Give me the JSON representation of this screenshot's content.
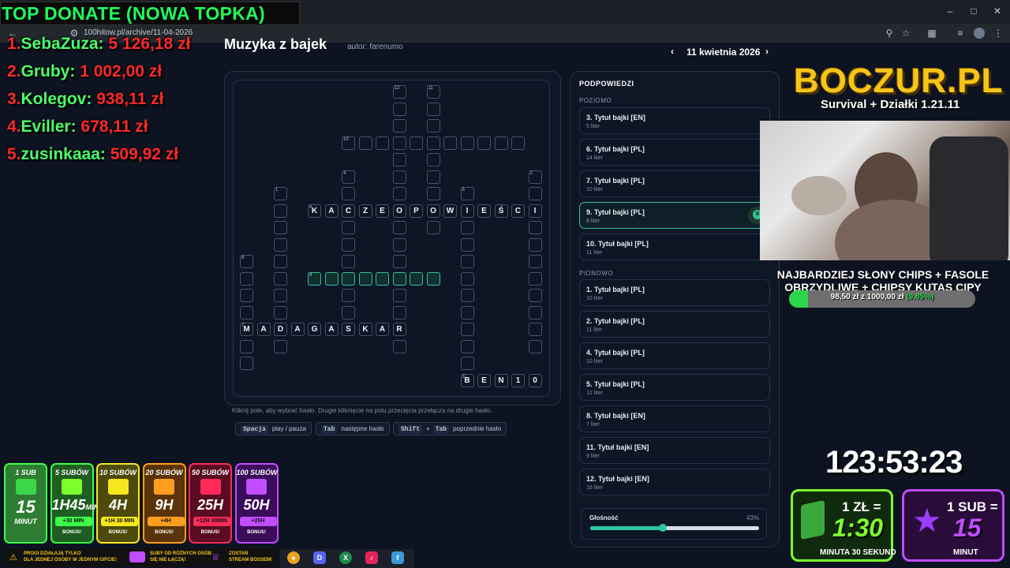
{
  "browser": {
    "url": "100hitow.pl/archive/11-04-2026",
    "window_controls": [
      "minimize-icon",
      "maximize-icon",
      "close-icon"
    ]
  },
  "donate": {
    "title": "TOP DONATE (NOWA TOPKA)",
    "entries": [
      {
        "rank": "1.",
        "name": "SebaZuza",
        "amount": "5 126,18 zł"
      },
      {
        "rank": "2.",
        "name": "Gruby",
        "amount": "1 002,00 zł"
      },
      {
        "rank": "3.",
        "name": "Kolegov",
        "amount": "938,11 zł"
      },
      {
        "rank": "4.",
        "name": "Eviller",
        "amount": "678,11 zł"
      },
      {
        "rank": "5.",
        "name": "zusinkaaa",
        "amount": "509,92 zł"
      }
    ]
  },
  "page": {
    "heading": "Muzyka z bajek",
    "author": "autor: farenumo",
    "date": "11 kwietnia 2026",
    "hint_text": "Kliknij pole, aby wybrać hasło. Drugie kliknięcie na polu przecięcia przełącza na drugie hasło.",
    "shortcuts": [
      {
        "key": "Spacja",
        "label": "play / pauza"
      },
      {
        "key": "Tab",
        "label": "następne hasło"
      },
      {
        "key": "Shift",
        "plus": "+",
        "key2": "Tab",
        "label": "poprzednie hasło"
      }
    ]
  },
  "hints": {
    "title": "PODPOWIEDZI",
    "across_title": "POZIOMO",
    "down_title": "PIONOWO",
    "across": [
      {
        "title": "3. Tytuł bajki [EN]",
        "sub": "5 liter"
      },
      {
        "title": "6. Tytuł bajki [PL]",
        "sub": "14 liter"
      },
      {
        "title": "7. Tytuł bajki [PL]",
        "sub": "10 liter"
      },
      {
        "title": "9. Tytuł bajki [PL]",
        "sub": "8 liter",
        "active": true
      },
      {
        "title": "10. Tytuł bajki [PL]",
        "sub": "11 liter"
      }
    ],
    "down": [
      {
        "title": "1. Tytuł bajki [PL]",
        "sub": "10 liter"
      },
      {
        "title": "2. Tytuł bajki [PL]",
        "sub": "11 liter"
      },
      {
        "title": "4. Tytuł bajki [PL]",
        "sub": "10 liter"
      },
      {
        "title": "5. Tytuł bajki [PL]",
        "sub": "12 liter"
      },
      {
        "title": "8. Tytuł bajki [EN]",
        "sub": "7 liter"
      },
      {
        "title": "11. Tytuł bajki [EN]",
        "sub": "9 liter"
      },
      {
        "title": "12. Tytuł bajki [EN]",
        "sub": "16 liter"
      }
    ],
    "volume_label": "Głośność",
    "volume_value": "43%",
    "volume_fraction": 0.43
  },
  "crossword": {
    "words": {
      "across_6": [
        "K",
        "A",
        "C",
        "Z",
        "E",
        "O",
        "P",
        "O",
        "W",
        "I",
        "E",
        "Ś",
        "C",
        "I"
      ],
      "across_7": [
        "M",
        "A",
        "D",
        "A",
        "G",
        "A",
        "S",
        "K",
        "A",
        "R"
      ],
      "across_3": [
        "B",
        "E",
        "N",
        "1",
        "0"
      ]
    },
    "clue_numbers": [
      "1",
      "2",
      "3",
      "4",
      "5",
      "6",
      "7",
      "8",
      "9",
      "10",
      "11",
      "12"
    ]
  },
  "overlay": {
    "logo_main": "BOCZUR.PL",
    "logo_sub": "Survival + Działki 1.21.11",
    "goal_line1": "NAJBARDZIEJ SŁONY CHIPS + FASOLE",
    "goal_line2": "OBRZYDLIWE + CHIPSY KUTAS CIPY",
    "goal_amount": "98,50 zł z 1000,00 zł",
    "goal_percent": "(9.85%)",
    "goal_fraction": 0.0985,
    "timer": "123:53:23",
    "rate_zl": {
      "top": "1 ZŁ =",
      "big": "1:30",
      "bottom": "MINUTA 30 SEKUND"
    },
    "rate_sub": {
      "top": "1 SUB =",
      "big": "15",
      "bottom": "MINUT"
    },
    "sub_goals": [
      {
        "title": "1 SUB",
        "val": "15",
        "unit": "MINUT",
        "extra": "",
        "bonus": "",
        "color": "#2e7d32",
        "border": "#3cff4a",
        "gift": "#3cd64a"
      },
      {
        "title": "5 SUBÓW",
        "val": "1H45",
        "unit": "MIN",
        "extra": "+30 MIN",
        "bonus": "BONUS!",
        "color": "#1f5d22",
        "border": "#3cff4a",
        "gift": "#7dff2d"
      },
      {
        "title": "10 SUBÓW",
        "val": "4H",
        "unit": "",
        "extra": "+1H 30 MIN",
        "bonus": "BONUS!",
        "color": "#4d4a0c",
        "border": "#f5e61e",
        "gift": "#f5e61e"
      },
      {
        "title": "20 SUBÓW",
        "val": "9H",
        "unit": "",
        "extra": "+4H",
        "bonus": "BONUS!",
        "color": "#5a3408",
        "border": "#ff9d1e",
        "gift": "#ff9d1e"
      },
      {
        "title": "50 SUBÓW",
        "val": "25H",
        "unit": "",
        "extra": "+12H 30MIN",
        "bonus": "BONUS!",
        "color": "#5a0c22",
        "border": "#ff2a5a",
        "gift": "#ff2a5a"
      },
      {
        "title": "100 SUBÓW",
        "val": "50H",
        "unit": "",
        "extra": "+25H",
        "bonus": "BONUS!",
        "color": "#3a0c5a",
        "border": "#c04dff",
        "gift": "#c04dff"
      }
    ],
    "info": [
      "PROGI DZIAŁAJĄ TYLKO",
      "DLA JEDNEJ OSOBY W JEDNYM GIFCIE!",
      "SUBY OD RÓŻNYCH OSÓB",
      "SIĘ NIE ŁĄCZĄ!",
      "ZOSTAŃ",
      "STREAM BOSSEM!"
    ]
  }
}
